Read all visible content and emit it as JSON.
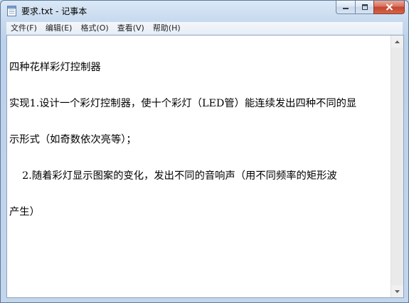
{
  "window": {
    "title": "要求.txt - 记事本",
    "icon": "notepad-icon"
  },
  "caption_buttons": {
    "minimize_icon": "minimize-icon",
    "maximize_icon": "maximize-icon",
    "close_icon": "close-icon"
  },
  "menu": {
    "items": [
      {
        "label": "文件(F)"
      },
      {
        "label": "编辑(E)"
      },
      {
        "label": "格式(O)"
      },
      {
        "label": "查看(V)"
      },
      {
        "label": "帮助(H)"
      }
    ]
  },
  "document": {
    "lines": [
      "四种花样彩灯控制器",
      "实现1.设计一个彩灯控制器，使十个彩灯（LED管）能连续发出四种不同的显",
      "示形式（如奇数依次亮等）；",
      "    2.随着彩灯显示图案的变化，发出不同的音响声（用不同频率的矩形波",
      "产生）"
    ]
  },
  "scrollbar": {
    "up_icon": "scroll-up-arrow-icon",
    "down_icon": "scroll-down-arrow-icon"
  }
}
